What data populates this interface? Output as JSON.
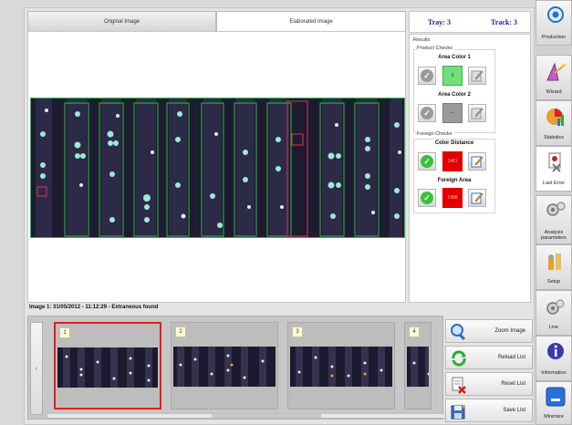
{
  "tabs": {
    "original": "Original Image",
    "elaborated": "Elaborated Image"
  },
  "header": {
    "tray": "Tray: 3",
    "track": "Track: 3"
  },
  "results": {
    "title": "Results",
    "product_checks": {
      "label": "Product Checks",
      "area_color_1": {
        "title": "Area Color 1",
        "value": "0",
        "status": "neutral"
      },
      "area_color_2": {
        "title": "Area Color 2",
        "value": "---",
        "status": "neutral"
      }
    },
    "foreign_checks": {
      "label": "Foreign Checks",
      "color_distance": {
        "title": "Color Distance",
        "value": "1461",
        "status": "fail"
      },
      "foreign_area": {
        "title": "Foreign Area",
        "value": "1488",
        "status": "fail"
      }
    }
  },
  "status_line": "Image 1: 31/05/2012 - 11:12:29  - Extraneous found",
  "thumbnails": [
    {
      "number": "1",
      "selected": true
    },
    {
      "number": "2",
      "selected": false
    },
    {
      "number": "3",
      "selected": false
    },
    {
      "number": "4",
      "selected": false
    }
  ],
  "thumb_arrows": {
    "left": "‹",
    "right": "›"
  },
  "list_buttons": {
    "zoom": "Zoom Image",
    "reload": "Reload List",
    "reset": "Reset List",
    "save": "Save List"
  },
  "nav": {
    "production": "Production",
    "wizard": "Wizard",
    "statistics": "Statistics",
    "last_error": "Last Error",
    "analysis": "Analysis parameters",
    "setup": "Setup",
    "live": "Live",
    "information": "Information",
    "minimize": "Minimize"
  },
  "colors": {
    "ok_green": "#39c23a",
    "fail_red": "#e00000",
    "value_green": "#72e07a",
    "accent_blue": "#1a1aa8",
    "selection_red": "#e02020"
  }
}
